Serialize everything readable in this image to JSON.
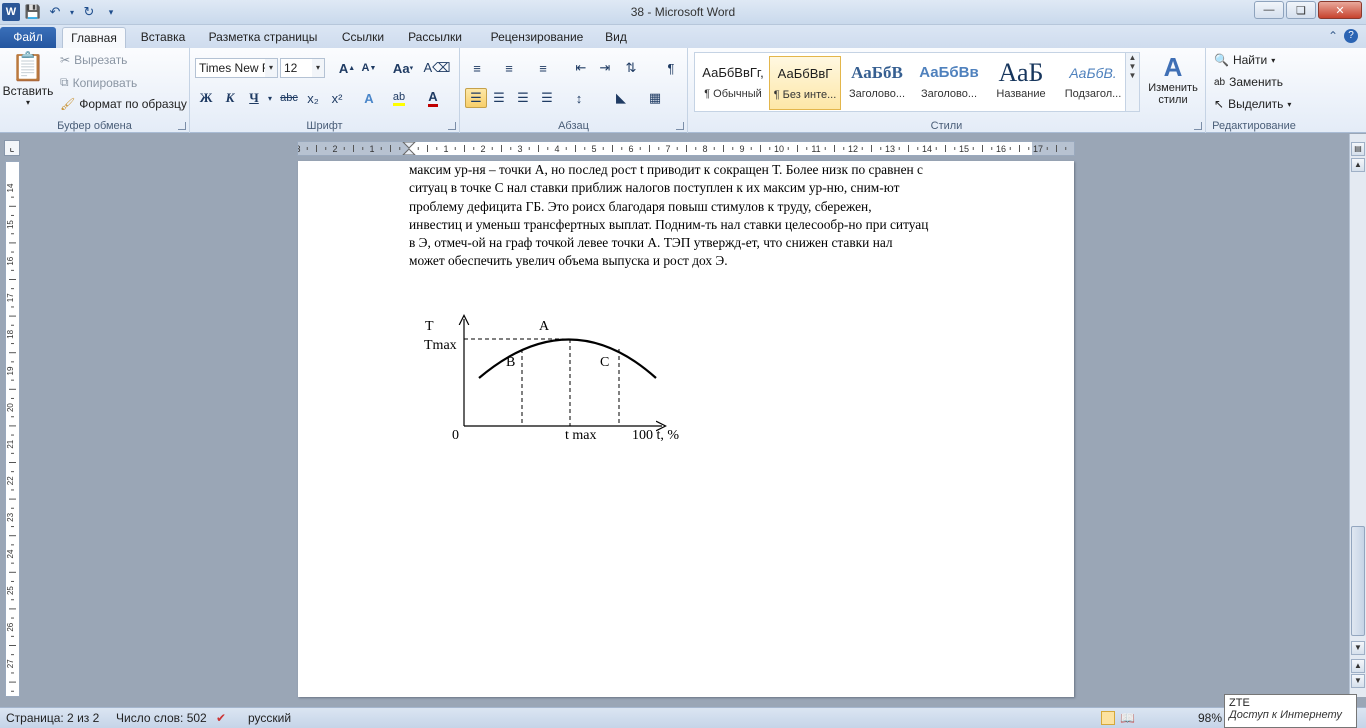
{
  "window": {
    "title": "38  -  Microsoft Word"
  },
  "tabs": {
    "file": "Файл",
    "items": [
      "Главная",
      "Вставка",
      "Разметка страницы",
      "Ссылки",
      "Рассылки",
      "Рецензирование",
      "Вид"
    ],
    "active": "Главная"
  },
  "clipboard": {
    "label": "Буфер обмена",
    "paste": "Вставить",
    "cut": "Вырезать",
    "copy": "Копировать",
    "format_painter": "Формат по образцу"
  },
  "font": {
    "label": "Шрифт",
    "name": "Times New Rc",
    "size": "12",
    "change_case": "Аа",
    "bold": "Ж",
    "italic": "К",
    "underline": "Ч",
    "strike": "abc",
    "subscript": "x₂",
    "superscript": "x²",
    "color_accent": "#c00000",
    "highlight_accent": "#ffff00"
  },
  "paragraph": {
    "label": "Абзац",
    "pilcrow": "¶"
  },
  "styles": {
    "label": "Стили",
    "tiles": [
      {
        "sample": "АаБбВвГг,",
        "name": "¶ Обычный"
      },
      {
        "sample": "АаБбВвГ",
        "name": "¶ Без инте..."
      },
      {
        "sample": "АаБбВ",
        "name": "Заголово..."
      },
      {
        "sample": "АаБбВв",
        "name": "Заголово..."
      },
      {
        "sample": "АаБ",
        "name": "Название"
      },
      {
        "sample": "АаБбВ.",
        "name": "Подзагол..."
      }
    ],
    "change": "Изменить стили"
  },
  "editing": {
    "label": "Редактирование",
    "find": "Найти",
    "replace": "Заменить",
    "select": "Выделить"
  },
  "ruler": {
    "h_labels": [
      "3",
      "2",
      "1",
      "",
      "1",
      "2",
      "3",
      "4",
      "5",
      "6",
      "7",
      "8",
      "9",
      "10",
      "11",
      "12",
      "13",
      "14",
      "15",
      "16",
      "17"
    ],
    "v_labels": [
      "14",
      "15",
      "16",
      "17",
      "18",
      "19",
      "20",
      "21",
      "22",
      "23",
      "24",
      "25",
      "26",
      "27"
    ]
  },
  "document": {
    "lines": [
      "максим ур-ня – точки А, но послед рост t приводит к сокращен Т. Более низк по сравнен с",
      "ситуац в точке С нал ставки приближ налогов поступлен к их максим ур-ню, сним-ют",
      "проблему дефицита ГБ. Это роисх благодаря повыш стимулов к труду, сбережен,",
      "инвестиц и уменьш трансфертных выплат. Подним-ть нал ставки целесообр-но при ситуац",
      "в Э, отмеч-ой на граф точкой левее точки А. ТЭП утвержд-ет, что снижен ставки нал",
      "может обеспечить увелич объема выпуска и рост дох Э."
    ],
    "figure": {
      "y_axis": "T",
      "y_max": "Tmax",
      "point_a": "A",
      "point_b": "B",
      "point_c": "C",
      "origin": "0",
      "x_max": "t max",
      "x_end": "100 t, %"
    }
  },
  "status": {
    "page": "Страница: 2 из 2",
    "words": "Число слов: 502",
    "language": "русский",
    "zoom": "98%"
  },
  "tooltip": {
    "title": "ZTE",
    "text": "Доступ к Интернету"
  }
}
